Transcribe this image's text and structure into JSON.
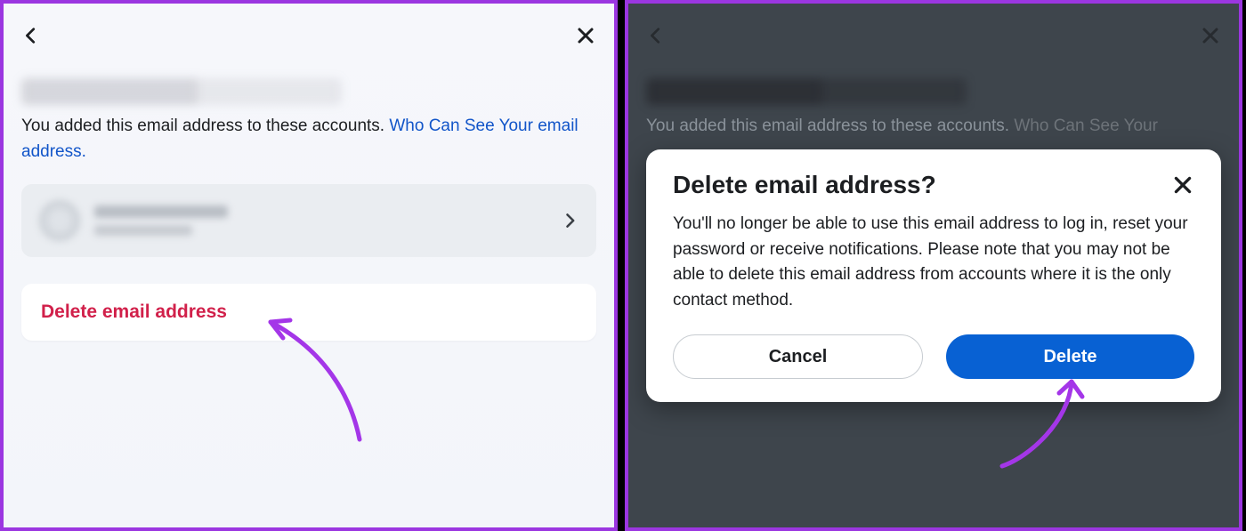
{
  "left": {
    "description_text": "You added this email address to these accounts. ",
    "description_link": "Who Can See Your email address.",
    "delete_label": "Delete email address"
  },
  "right": {
    "description_text": "You added this email address to these accounts. ",
    "description_link": "Who Can See Your",
    "modal": {
      "title": "Delete email address?",
      "body": "You'll no longer be able to use this email address to log in, reset your password or receive notifications. Please note that you may not be able to delete this email address from accounts where it is the only contact method.",
      "cancel": "Cancel",
      "delete": "Delete"
    }
  },
  "colors": {
    "accent_purple": "#9b36e0",
    "link_blue": "#1255c9",
    "danger_red": "#d1204a",
    "primary_blue": "#0861d3"
  }
}
